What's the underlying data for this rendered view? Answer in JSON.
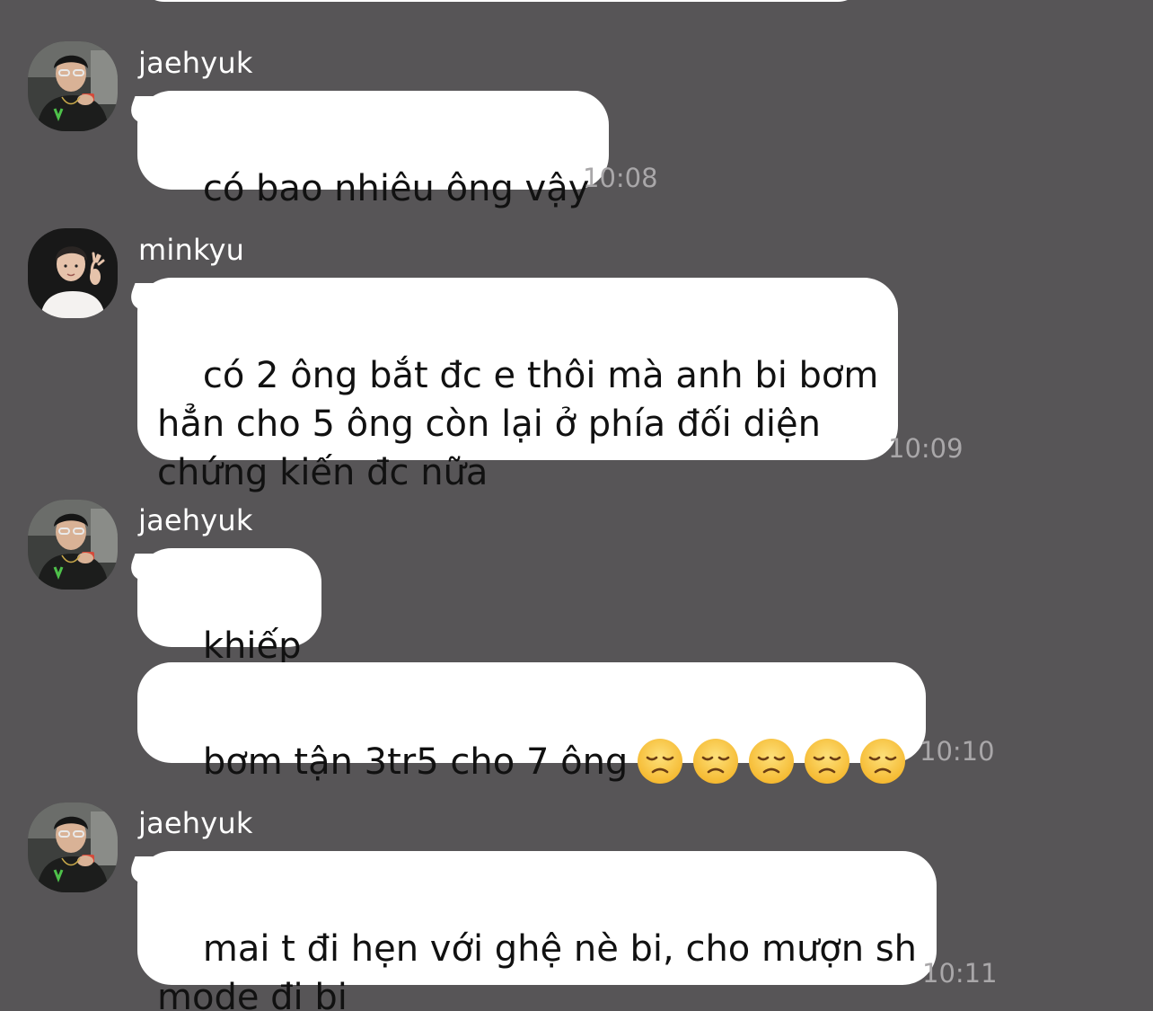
{
  "messages": [
    {
      "sender": "jaehyuk",
      "avatar_icon": "user-avatar-jaehyuk",
      "bubbles": [
        {
          "text": "có bao nhiêu ông vậy"
        }
      ],
      "time": "10:08"
    },
    {
      "sender": "minkyu",
      "avatar_icon": "user-avatar-minkyu",
      "bubbles": [
        {
          "text": "có 2 ông bắt đc e thôi mà anh bi bơm\nhẳn cho 5 ông còn lại ở phía đối diện\nchứng kiến đc nữa"
        }
      ],
      "time": "10:09"
    },
    {
      "sender": "jaehyuk",
      "avatar_icon": "user-avatar-jaehyuk",
      "bubbles": [
        {
          "text": "khiếp"
        },
        {
          "text": "bơm tận 3tr5 cho 7 ông",
          "emoji": "disappointed-face-icon",
          "emoji_count": 5
        }
      ],
      "time": "10:10"
    },
    {
      "sender": "jaehyuk",
      "avatar_icon": "user-avatar-jaehyuk",
      "bubbles": [
        {
          "text": "mai t đi hẹn với ghệ nè bi, cho mượn sh\nmode đi bi"
        }
      ],
      "time": "10:11"
    }
  ],
  "colors": {
    "background": "#575557",
    "bubble": "#ffffff",
    "bubble_text": "#111111",
    "sender_name": "#ffffff",
    "timestamp": "#a9a7a9",
    "emoji_face": "#f7c33c"
  }
}
